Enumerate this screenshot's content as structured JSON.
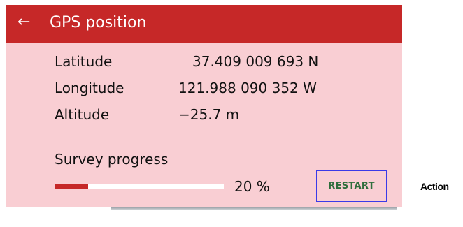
{
  "header": {
    "back_icon": "←",
    "title": "GPS position",
    "background_color": "#c62828"
  },
  "coordinates": {
    "latitude": {
      "label": "Latitude",
      "value": "37.409 009 693 N"
    },
    "longitude": {
      "label": "Longitude",
      "value": "121.988 090 352 W"
    },
    "altitude": {
      "label": "Altitude",
      "value": "−25.7 m"
    }
  },
  "survey": {
    "label": "Survey progress",
    "progress_fraction": 0.2,
    "percent_text": "20 %"
  },
  "restart_button": {
    "label": "RESTART"
  },
  "annotation": {
    "label": "Action"
  },
  "colors": {
    "panel_background": "#f9ced3",
    "accent": "#c62828",
    "button_text": "#2e6e3c",
    "annotation_outline": "#3a3ae8"
  },
  "icons": {
    "back": "back-arrow-icon"
  }
}
